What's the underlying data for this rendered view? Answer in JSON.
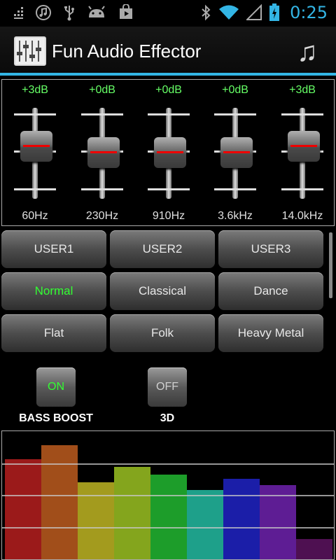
{
  "status": {
    "time": "0:25",
    "left_icons": [
      "menu-dots-icon",
      "music-note-icon",
      "usb-icon",
      "android-icon",
      "store-icon"
    ],
    "right_icons": [
      "bluetooth-icon",
      "wifi-icon",
      "signal-icon",
      "battery-icon"
    ],
    "accent": "#33b5e5"
  },
  "app": {
    "title": "Fun Audio Effector",
    "icon": "equalizer-icon",
    "action_icon": "music-note-icon"
  },
  "equalizer": {
    "bands": [
      {
        "gain": "+3dB",
        "freq": "60Hz",
        "value_db": 3
      },
      {
        "gain": "+0dB",
        "freq": "230Hz",
        "value_db": 0
      },
      {
        "gain": "+0dB",
        "freq": "910Hz",
        "value_db": 0
      },
      {
        "gain": "+0dB",
        "freq": "3.6kHz",
        "value_db": 0
      },
      {
        "gain": "+3dB",
        "freq": "14.0kHz",
        "value_db": 3
      }
    ],
    "gain_color": "#66ff66"
  },
  "presets": {
    "items": [
      "USER1",
      "USER2",
      "USER3",
      "Normal",
      "Classical",
      "Dance",
      "Flat",
      "Folk",
      "Heavy Metal"
    ],
    "selected": "Normal"
  },
  "effects": {
    "bass_boost": {
      "label": "BASS BOOST",
      "state": "ON"
    },
    "three_d": {
      "label": "3D",
      "state": "OFF"
    }
  },
  "visualizer": {
    "colors": [
      "#9b1a1a",
      "#a14e1a",
      "#a39b1e",
      "#84a51d",
      "#1d9d2a",
      "#1ea08a",
      "#1b1ea8",
      "#5e1d94",
      "#4e1051"
    ],
    "levels": [
      0.78,
      0.89,
      0.6,
      0.72,
      0.66,
      0.54,
      0.63,
      0.58,
      0.16
    ]
  }
}
